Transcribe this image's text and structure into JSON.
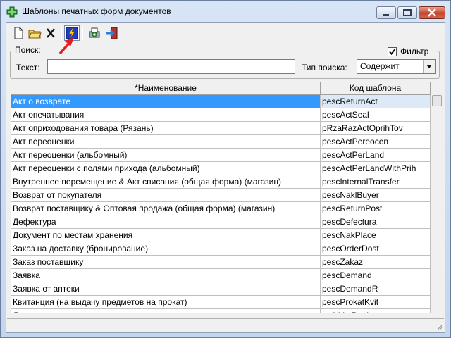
{
  "window": {
    "title": "Шаблоны печатных форм документов"
  },
  "search": {
    "group_label": "Поиск:",
    "text_label": "Текст:",
    "text_value": "",
    "type_label": "Тип поиска:",
    "type_value": "Содержит",
    "filter_label": "Фильтр",
    "filter_checked": true
  },
  "toolbar": {
    "buttons": [
      {
        "name": "new-icon"
      },
      {
        "name": "open-folder-icon"
      },
      {
        "name": "delete-icon"
      },
      {
        "name": "lightning-icon"
      },
      {
        "name": "print-preview-icon"
      },
      {
        "name": "exit-icon"
      }
    ]
  },
  "table": {
    "headers": [
      "*Наименование",
      "Код шаблона"
    ],
    "rows": [
      [
        "Акт о возврате",
        "pescReturnAct"
      ],
      [
        "Акт опечатывания",
        "pescActSeal"
      ],
      [
        "Акт оприходования товара (Рязань)",
        "pRzaRazActOprihTov"
      ],
      [
        "Акт переоценки",
        "pescActPereocen"
      ],
      [
        "Акт переоценки (альбомный)",
        "pescActPerLand"
      ],
      [
        "Акт переоценки с полями прихода (альбомный)",
        "pescActPerLandWithPrih"
      ],
      [
        "Внутреннее перемещение & Акт списания (общая форма) (магазин)",
        "pescInternalTransfer"
      ],
      [
        "Возврат от покупателя",
        "pescNaklBuyer"
      ],
      [
        "Возврат поставщику & Оптовая продажа (общая форма) (магазин)",
        "pescReturnPost"
      ],
      [
        "Дефектура",
        "pescDefectura"
      ],
      [
        "Документ по местам хранения",
        "pescNakPlace"
      ],
      [
        "Заказ на доставку (бронирование)",
        "pescOrderDost"
      ],
      [
        "Заказ поставщику",
        "pescZakaz"
      ],
      [
        "Заявка",
        "pescDemand"
      ],
      [
        "Заявка от аптеки",
        "pescDemandR"
      ],
      [
        "Квитанция (на выдачу предметов на прокат)",
        "pescProkatKvit"
      ],
      [
        "Лист регистрации поступивших товаров",
        "pefkListRegistr"
      ]
    ]
  },
  "colors": {
    "selection": "#3399ff",
    "accent_arrow": "#e02020"
  }
}
